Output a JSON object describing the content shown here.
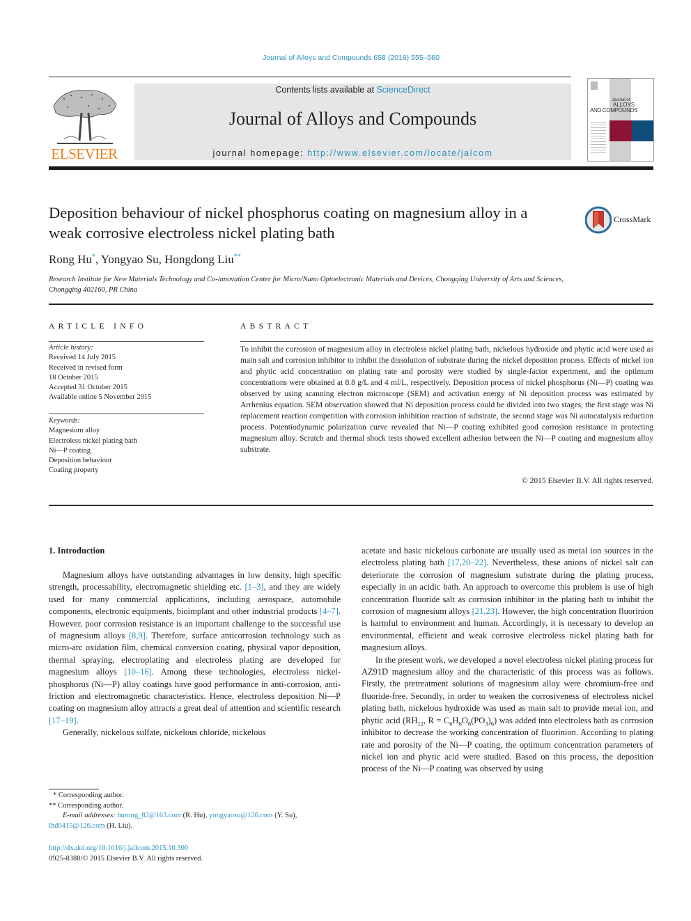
{
  "header": {
    "citation": "Journal of Alloys and Compounds 658 (2016) 555–560",
    "publisher_logo_text": "ELSEVIER",
    "contents_prefix": "Contents lists available at ",
    "contents_link": "ScienceDirect",
    "journal_title": "Journal of Alloys and Compounds",
    "homepage_prefix": "journal homepage: ",
    "homepage_url": "http://www.elsevier.com/locate/jalcom",
    "cover": {
      "line1": "Journal of",
      "line2": "ALLOYS",
      "line3": "AND COMPOUNDS",
      "accent_red": "#8b1436",
      "accent_blue": "#0f4e78"
    }
  },
  "article": {
    "title": "Deposition behaviour of nickel phosphorus coating on magnesium alloy in a weak corrosive electroless nickel plating bath",
    "crossmark_label": "CrossMark",
    "authors": [
      {
        "name": "Rong Hu",
        "mark": "*"
      },
      {
        "name": "Yongyao Su",
        "mark": ""
      },
      {
        "name": "Hongdong Liu",
        "mark": "**"
      }
    ],
    "affiliation": "Research Institute for New Materials Technology and Co-innovation Center for Micro/Nano Optoelectronic Materials and Devices, Chongqing University of Arts and Sciences, Chongqing 402160, PR China"
  },
  "article_info": {
    "heading": "ARTICLE INFO",
    "history_label": "Article history:",
    "history": [
      "Received 14 July 2015",
      "Received in revised form",
      "18 October 2015",
      "Accepted 31 October 2015",
      "Available online 5 November 2015"
    ],
    "keywords_label": "Keywords:",
    "keywords": [
      "Magnesium alloy",
      "Electroless nickel plating bath",
      "Ni—P coating",
      "Deposition behaviour",
      "Coating property"
    ]
  },
  "abstract": {
    "heading": "ABSTRACT",
    "text": "To inhibit the corrosion of magnesium alloy in electroless nickel plating bath, nickelous hydroxide and phytic acid were used as main salt and corrosion inhibitor to inhibit the dissolution of substrate during the nickel deposition process. Effects of nickel ion and phytic acid concentration on plating rate and porosity were studied by single-factor experiment, and the optimum concentrations were obtained at 8.8 g/L and 4 ml/L, respectively. Deposition process of nickel phosphorus (Ni—P) coating was observed by using scanning electron microscope (SEM) and activation energy of Ni deposition process was estimated by Arrhenius equation. SEM observation showed that Ni deposition process could be divided into two stages, the first stage was Ni replacement reaction competition with corrosion inhibition reaction of substrate, the second stage was Ni autocatalysis reduction process. Potentiodynamic polarization curve revealed that Ni—P coating exhibited good corrosion resistance in protecting magnesium alloy. Scratch and thermal shock tests showed excellent adhesion between the Ni—P coating and magnesium alloy substrate.",
    "copyright": "© 2015 Elsevier B.V. All rights reserved."
  },
  "introduction": {
    "heading": "1.  Introduction",
    "left_p1": [
      {
        "t": "Magnesium alloys have outstanding advantages in low density, high specific strength, processability, electromagnetic shielding etc. "
      },
      {
        "ref": "[1–3]"
      },
      {
        "t": ", and they are widely used for many commercial applications, including aerospace, automobile components, electronic equipments, bioimplant and other industrial products "
      },
      {
        "ref": "[4–7]"
      },
      {
        "t": ". However, poor corrosion resistance is an important challenge to the successful use of magnesium alloys "
      },
      {
        "ref": "[8,9]"
      },
      {
        "t": ". Therefore, surface anticorrosion technology such as micro-arc oxidation film, chemical conversion coating, physical vapor deposition, thermal spraying, electroplating and electroless plating are developed for magnesium alloys "
      },
      {
        "ref": "[10–16]"
      },
      {
        "t": ". Among these technologies, electroless nickel-phosphorus (Ni—P) alloy coatings have good performance in anti-corrosion, anti-friction and electromagnetic characteristics. Hence, electroless deposition Ni—P coating on magnesium alloy attracts a great deal of attention and scientific research "
      },
      {
        "ref": "[17–19]"
      },
      {
        "t": "."
      }
    ],
    "left_p2": "Generally, nickelous sulfate, nickelous chloride, nickelous",
    "right_p1": [
      {
        "t": "acetate and basic nickelous carbonate are usually used as metal ion sources in the electroless plating bath "
      },
      {
        "ref": "[17,20–22]"
      },
      {
        "t": ". Nevertheless, these anions of nickel salt can deteriorate the corrosion of magnesium substrate during the plating process, especially in an acidic bath. An approach to overcome this problem is use of high concentration fluoride salt as corrosion inhibitor in the plating bath to inhibit the corrosion of magnesium alloys "
      },
      {
        "ref": "[21,23]"
      },
      {
        "t": ". However, the high concentration fluorinion is harmful to environment and human. Accordingly, it is necessary to develop an environmental, efficient and weak corrosive electroless nickel plating bath for magnesium alloys."
      }
    ],
    "right_p2_a": "In the present work, we developed a novel electroless nickel plating process for AZ91D magnesium alloy and the characteristic of this process was as follows. Firstly, the pretreatment solutions of magnesium alloy were chromium-free and fluoride-free. Secondly, in order to weaken the corrosiveness of electroless nickel plating bath, nickelous hydroxide was used as main salt to provide metal ion, and phytic acid (RH",
    "right_p2_sub1": "12",
    "right_p2_b": ", R = C",
    "right_p2_sub2": "6",
    "right_p2_c": "H",
    "right_p2_sub3": "6",
    "right_p2_d": "O",
    "right_p2_sub4": "6",
    "right_p2_e": "(PO",
    "right_p2_sub5": "3",
    "right_p2_f": ")",
    "right_p2_sub6": "6",
    "right_p2_g": ") was added into electroless bath as corrosion inhibitor to decrease the working concentration of fluorinion. According to plating rate and porosity of the Ni—P coating, the optimum concentration parameters of nickel ion and phytic acid were studied. Based on this process, the deposition process of the Ni—P coating was observed by using"
  },
  "footnotes": {
    "fn1": "* Corresponding author.",
    "fn2": "** Corresponding author.",
    "email_label": "E-mail addresses: ",
    "emails": [
      {
        "addr": "hurong_82@163.com",
        "who": " (R. Hu), "
      },
      {
        "addr": "yongyaosu@126.com",
        "who": " (Y. Su), "
      },
      {
        "addr": "lhd0415@126.com",
        "who": " (H. Liu)."
      }
    ],
    "doi": "http://dx.doi.org/10.1016/j.jallcom.2015.10.300",
    "issn_line": "0925-8388/© 2015 Elsevier B.V. All rights reserved."
  },
  "colors": {
    "link": "#2a8fbf",
    "elsevier_orange": "#f07c1a",
    "masthead_bg": "#e6e6e6"
  }
}
